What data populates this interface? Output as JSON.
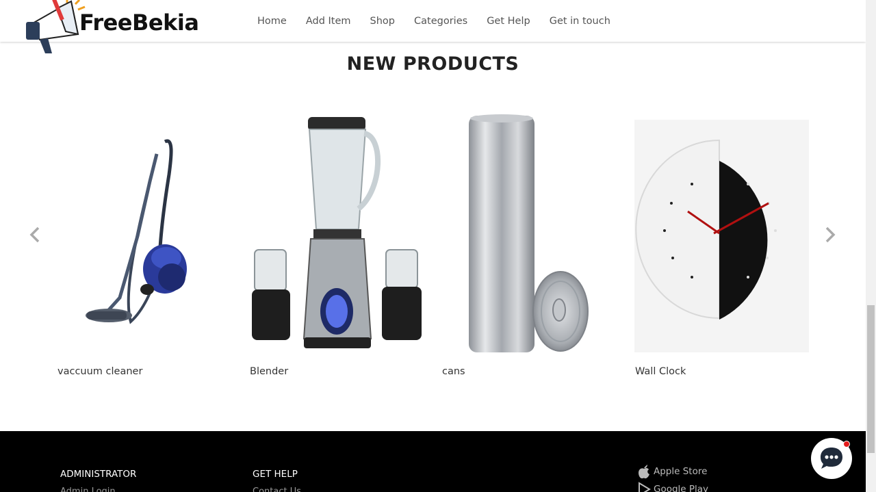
{
  "header": {
    "brand": "FreeBekia",
    "nav": [
      "Home",
      "Add Item",
      "Shop",
      "Categories",
      "Get Help",
      "Get in touch"
    ]
  },
  "section": {
    "title": "NEW PRODUCTS"
  },
  "products": [
    {
      "name": "vaccuum cleaner",
      "icon": "vacuum-cleaner-image"
    },
    {
      "name": "Blender",
      "icon": "blender-image"
    },
    {
      "name": "cans",
      "icon": "aluminum-can-image"
    },
    {
      "name": "Wall Clock",
      "icon": "wall-clock-image"
    }
  ],
  "carousel": {
    "prev_icon": "chevron-left-icon",
    "next_icon": "chevron-right-icon"
  },
  "footer": {
    "administrator_heading": "ADMINISTRATOR",
    "admin_link": "Admin Login",
    "get_help_heading": "GET HELP",
    "contact_link": "Contact Us",
    "apple_store": "Apple Store",
    "google_play": "Google Play"
  },
  "chat": {
    "icon": "chat-bubble-icon",
    "badge_color": "#e41c1c"
  },
  "colors": {
    "footer_bg": "#000000",
    "clock_hands": "#b01010",
    "vacuum_body": "#2a3a9a"
  }
}
